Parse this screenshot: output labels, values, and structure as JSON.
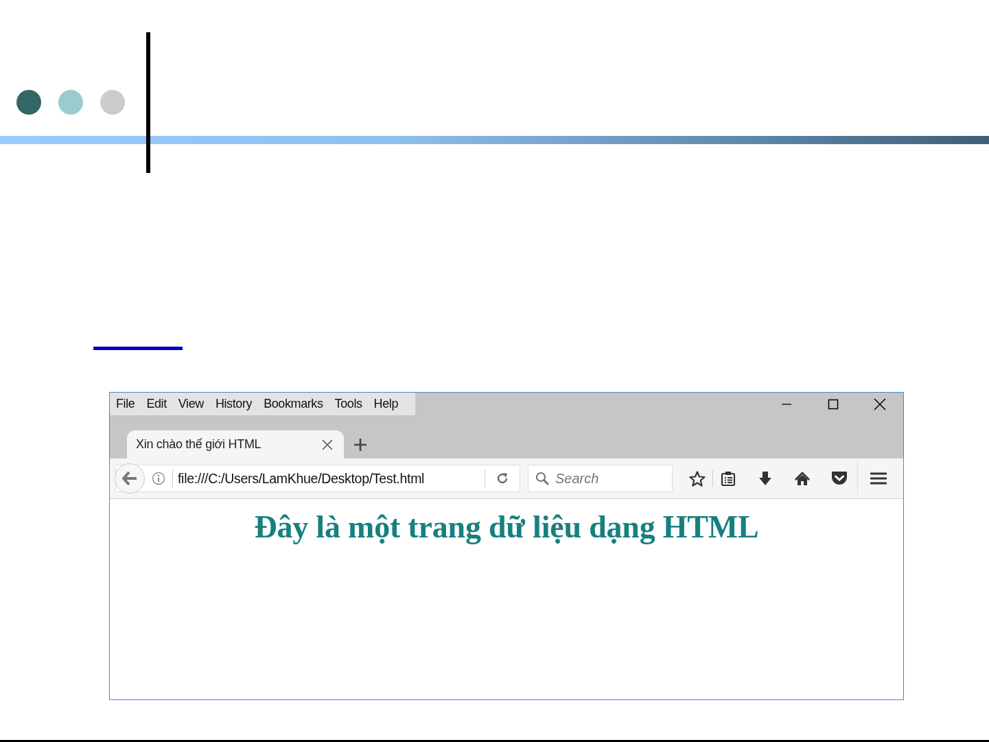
{
  "slide": {
    "dots": [
      {
        "color": "#336666"
      },
      {
        "color": "#99cccc"
      },
      {
        "color": "#cccccc"
      }
    ]
  },
  "browser": {
    "menu": [
      "File",
      "Edit",
      "View",
      "History",
      "Bookmarks",
      "Tools",
      "Help"
    ],
    "tabs": [
      {
        "label": "Xin chào thế giới HTML",
        "selected": true
      }
    ],
    "address": {
      "value": "file:///C:/Users/LamKhue/Desktop/Test.html"
    },
    "search": {
      "placeholder": "Search"
    },
    "page": {
      "heading": "Đây là một trang dữ liệu dạng HTML"
    }
  }
}
